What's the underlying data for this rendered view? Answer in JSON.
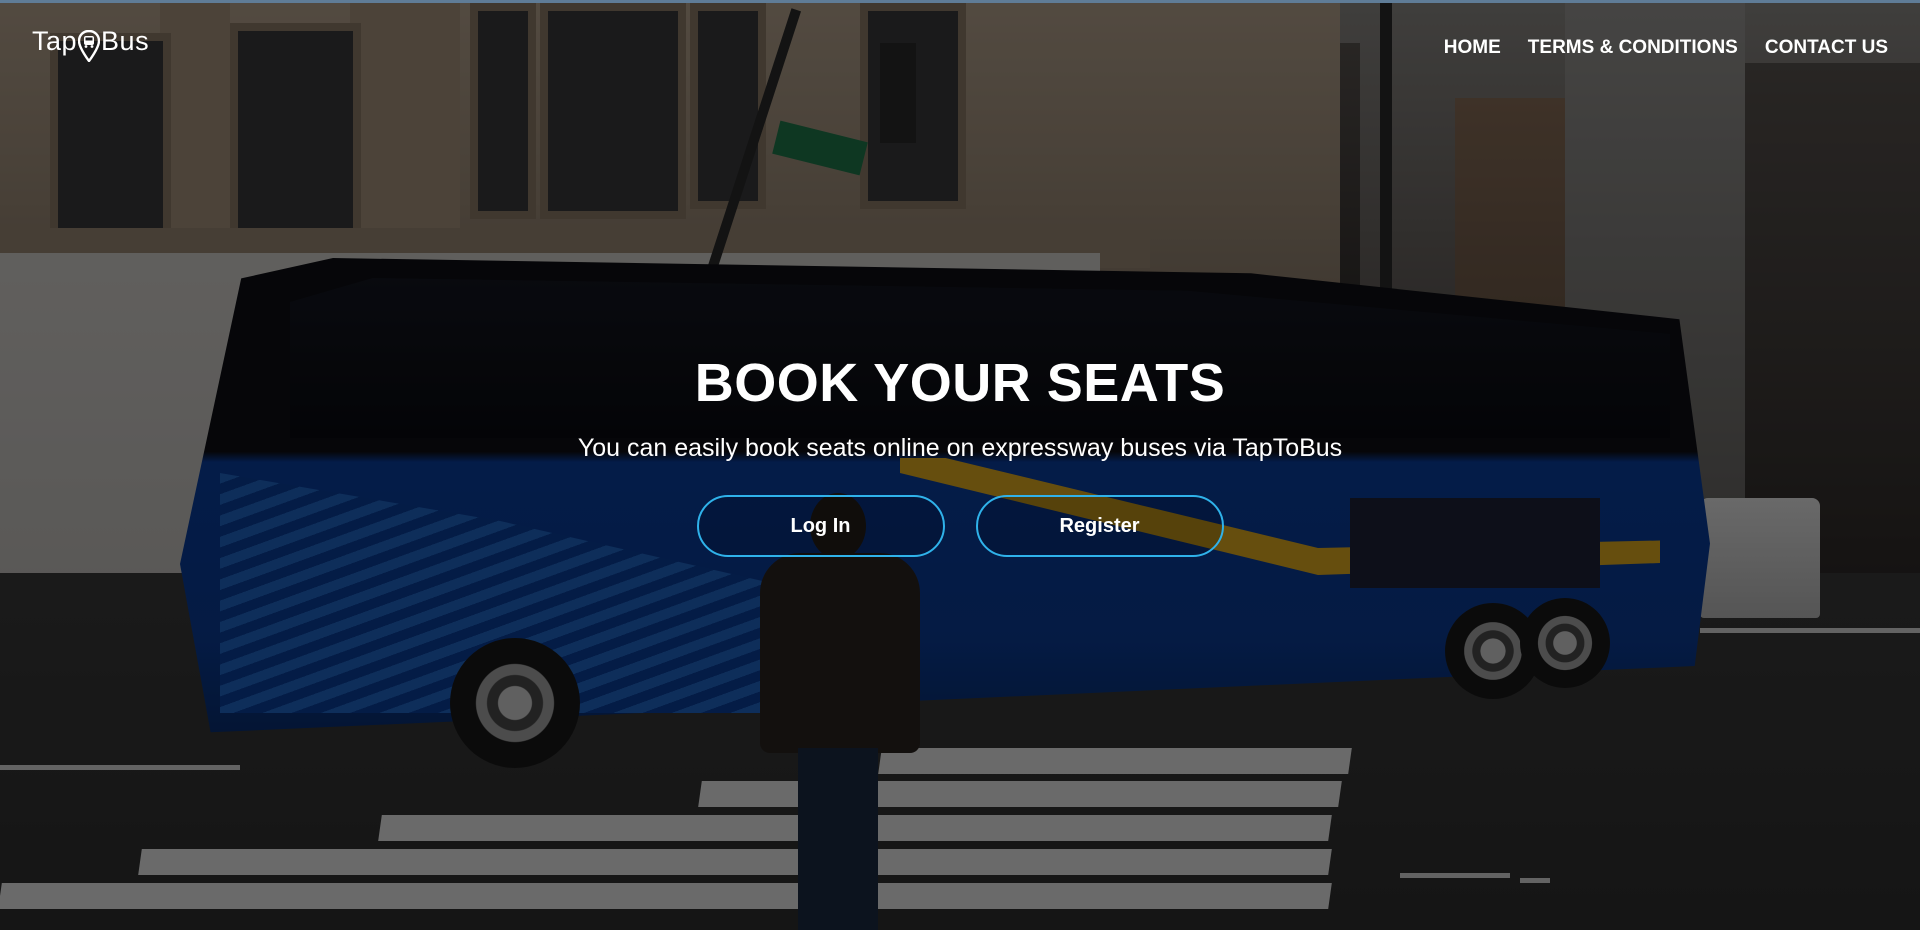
{
  "brand": {
    "name_left": "Tap",
    "name_right": "Bus",
    "logo_icon": "location-pin-bus-icon"
  },
  "nav": {
    "items": [
      {
        "label": "HOME"
      },
      {
        "label": "TERMS & CONDITIONS"
      },
      {
        "label": "CONTACT US"
      }
    ]
  },
  "hero": {
    "title": "BOOK YOUR SEATS",
    "subtitle": "You can easily book seats online on expressway buses via TapToBus",
    "login_label": "Log In",
    "register_label": "Register"
  },
  "colors": {
    "button_border": "#2fb2ea",
    "text": "#ffffff",
    "overlay": "rgba(0,0,0,0.55)"
  }
}
